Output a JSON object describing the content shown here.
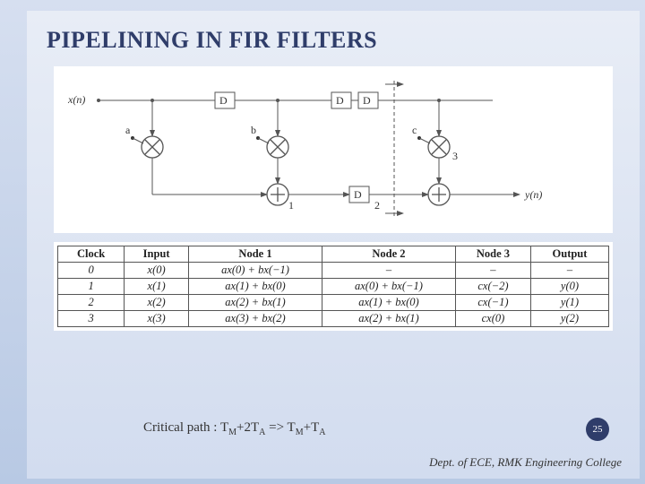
{
  "title": "PIPELINING IN FIR FILTERS",
  "diagram": {
    "input": "x(n)",
    "output": "y(n)",
    "delays": [
      "D",
      "D",
      "D",
      "D"
    ],
    "taps": [
      "a",
      "b",
      "c"
    ],
    "mult_label_right": "3",
    "add_labels": [
      "1",
      "2"
    ],
    "cut_line": "dashed"
  },
  "table": {
    "headers": [
      "Clock",
      "Input",
      "Node 1",
      "Node 2",
      "Node 3",
      "Output"
    ],
    "rows": [
      [
        "0",
        "x(0)",
        "ax(0) + bx(−1)",
        "–",
        "–",
        "–"
      ],
      [
        "1",
        "x(1)",
        "ax(1) + bx(0)",
        "ax(0) + bx(−1)",
        "cx(−2)",
        "y(0)"
      ],
      [
        "2",
        "x(2)",
        "ax(2) + bx(1)",
        "ax(1) + bx(0)",
        "cx(−1)",
        "y(1)"
      ],
      [
        "3",
        "x(3)",
        "ax(3) + bx(2)",
        "ax(2) + bx(1)",
        "cx(0)",
        "y(2)"
      ]
    ]
  },
  "critical_path": {
    "prefix": "Critical path : T",
    "sub1": "M",
    "mid1": "+2T",
    "sub2": "A",
    "mid2": " => T",
    "sub3": "M",
    "mid3": "+T",
    "sub4": "A"
  },
  "page_number": "25",
  "footer": "Dept. of ECE, RMK Engineering College"
}
